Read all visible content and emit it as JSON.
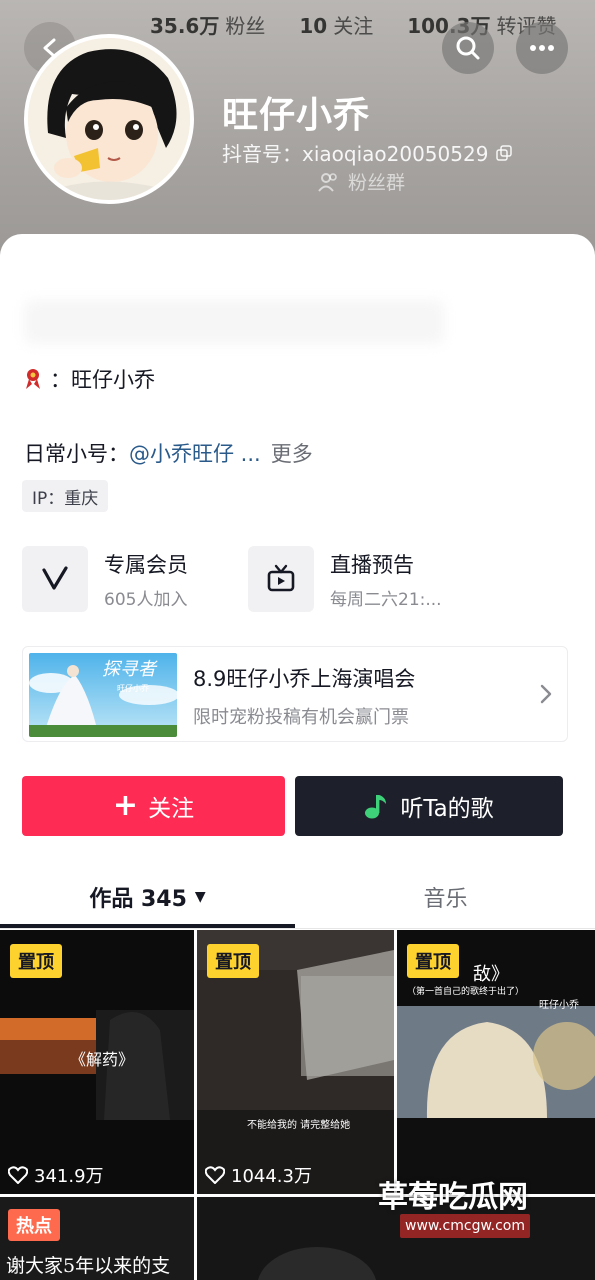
{
  "header": {
    "stats": [
      {
        "value": "35.6万",
        "label": "粉丝"
      },
      {
        "value": "10",
        "label": "关注"
      },
      {
        "value": "100.3万",
        "label": "转评赞"
      }
    ],
    "nickname": "旺仔小乔",
    "douyin_id": "抖音号：xiaoqiao20050529",
    "fans_group": "粉丝群"
  },
  "profile": {
    "bio_line1_suffix": "：旺仔小乔",
    "bio_line2_prefix": "日常小号：",
    "bio_line2_mention": "@小乔旺仔 ...",
    "bio_line2_more": "更多",
    "ip": "IP：重庆"
  },
  "services": {
    "vip": {
      "title": "专属会员",
      "sub": "605人加入",
      "icon": "v-icon"
    },
    "live": {
      "title": "直播预告",
      "sub": "每周二六21:...",
      "icon": "tv-icon"
    }
  },
  "concert": {
    "title": "8.9旺仔小乔上海演唱会",
    "subtitle": "限时宠粉投稿有机会赢门票",
    "poster_title": "探寻者",
    "poster_sub": "旺仔小乔"
  },
  "actions": {
    "follow": "关注",
    "listen": "听Ta的歌"
  },
  "tabs": {
    "works": "作品 345",
    "music": "音乐"
  },
  "videos": [
    {
      "badge": "置顶",
      "likes": "341.9万",
      "caption": "《解药》"
    },
    {
      "badge": "置顶",
      "likes": "1044.3万",
      "caption": "不能给我的 请完整给她"
    },
    {
      "badge": "置顶",
      "likes": "",
      "caption": "敌》",
      "caption_sub": "（第一首自己的歌终于出了）",
      "caption_right": "旺仔小乔"
    },
    {
      "badge": "热点",
      "caption": "谢大家5年以来的支"
    }
  ],
  "watermark": {
    "name": "草莓吃瓜网",
    "url": "www.cmcgw.com"
  },
  "colors": {
    "follow": "#fe2c55",
    "dark_button": "#1d1f2a",
    "pin_badge": "#fdd22e",
    "hot_badge": "#fe6a4d",
    "mention": "#2a5a8a"
  }
}
